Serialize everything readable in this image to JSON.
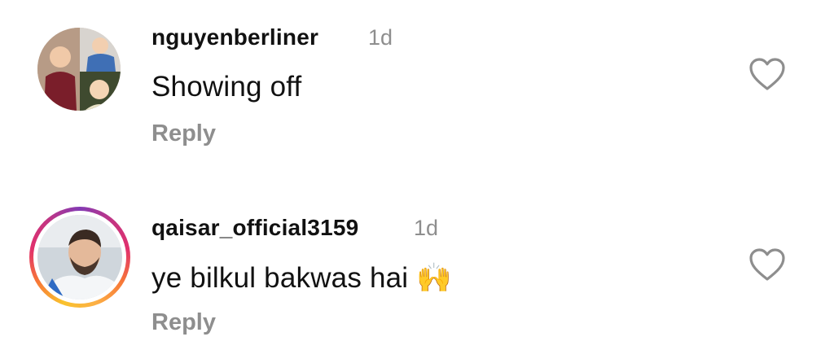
{
  "comments": [
    {
      "username": "nguyenberliner",
      "time": "1d",
      "text": "Showing off",
      "reply_label": "Reply"
    },
    {
      "username": "qaisar_official3159",
      "time": "1d",
      "text": "ye bilkul bakwas hai 🙌",
      "reply_label": "Reply",
      "has_story": true
    }
  ],
  "colors": {
    "secondary_text": "#8e8e8e",
    "primary_text": "#111111",
    "background": "#ffffff"
  },
  "icons": [
    "heart-outline-icon"
  ]
}
